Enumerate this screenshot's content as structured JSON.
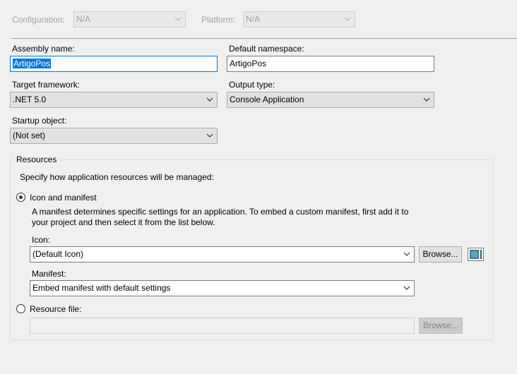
{
  "top": {
    "configuration_label": "Configuration:",
    "configuration_value": "N/A",
    "platform_label": "Platform:",
    "platform_value": "N/A"
  },
  "assembly_name": {
    "label": "Assembly name:",
    "value": "ArtigoPos"
  },
  "default_namespace": {
    "label": "Default namespace:",
    "value": "ArtigoPos"
  },
  "target_framework": {
    "label": "Target framework:",
    "value": ".NET 5.0"
  },
  "output_type": {
    "label": "Output type:",
    "value": "Console Application"
  },
  "startup_object": {
    "label": "Startup object:",
    "value": "(Not set)"
  },
  "resources": {
    "title": "Resources",
    "description": "Specify how application resources will be managed:",
    "icon_manifest_radio": {
      "label": "Icon and manifest",
      "selected": true
    },
    "manifest_note_line1": "A manifest determines specific settings for an application. To embed a custom manifest, first add it to",
    "manifest_note_line2": "your project and then select it from the list below.",
    "icon_label": "Icon:",
    "icon_value": "(Default Icon)",
    "browse_label": "Browse...",
    "manifest_label": "Manifest:",
    "manifest_value": "Embed manifest with default settings",
    "resource_file_radio": {
      "label": "Resource file:",
      "selected": false
    },
    "resource_file_value": "",
    "resource_browse_label": "Browse..."
  },
  "colors": {
    "selection": "#0078d7",
    "background": "#f0f0f0"
  }
}
